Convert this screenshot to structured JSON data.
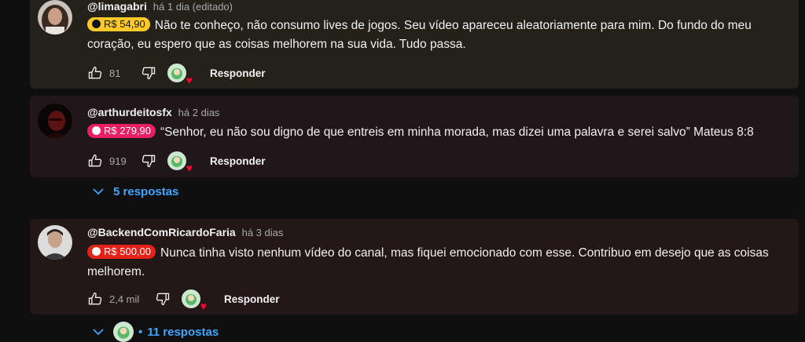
{
  "comments": [
    {
      "handle": "@limagabri",
      "time": "há 1 dia (editado)",
      "amount": "R$ 54,90",
      "text": "Não te conheço, não consumo lives de jogos. Seu vídeo apareceu aleatoriamente para mim. Do fundo do meu coração, eu espero que as coisas melhorem na sua vida. Tudo passa.",
      "likes": "81",
      "reply_label": "Responder",
      "badge_color": "#ffca28",
      "avatar_color": "#5a4e48"
    },
    {
      "handle": "@arthurdeitosfx",
      "time": "há 2 dias",
      "amount": "R$ 279,90",
      "text": "“Senhor, eu não sou digno de que entreis em minha morada, mas dizei uma palavra e serei salvo” Mateus 8:8",
      "likes": "919",
      "reply_label": "Responder",
      "replies_label": "5 respostas",
      "badge_color": "#e91e63",
      "avatar_color": "#2a0c0c"
    },
    {
      "handle": "@BackendComRicardoFaria",
      "time": "há 3 dias",
      "amount": "R$ 500,00",
      "text": "Nunca tinha visto nenhum vídeo do canal, mas fiquei emocionado com esse. Contribuo em desejo que as coisas melhorem.",
      "likes": "2,4 mil",
      "reply_label": "Responder",
      "replies_label": "11 respostas",
      "badge_color": "#e62117",
      "avatar_color": "#d7d7d7"
    }
  ],
  "icons": {
    "like": "thumb-up-icon",
    "dislike": "thumb-down-icon",
    "creator_heart": "creator-heart-icon",
    "expand": "chevron-down-icon"
  }
}
